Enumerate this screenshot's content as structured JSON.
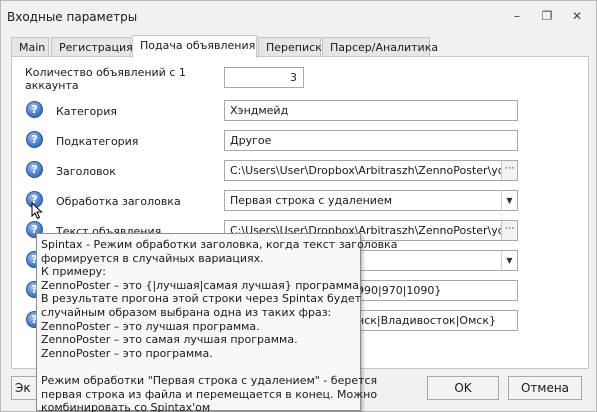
{
  "window": {
    "title": "Входные параметры"
  },
  "tabs": [
    {
      "label": "Main"
    },
    {
      "label": "Регистрация"
    },
    {
      "label": "Подача объявления",
      "active": true
    },
    {
      "label": "Переписка"
    },
    {
      "label": "Парсер/Аналитика"
    }
  ],
  "form": {
    "count_label": "Количество объявлений с 1 аккаунта",
    "count_label_line1": "Количество объявлений с 1",
    "count_label_line2": "аккаунта",
    "count_value": "3",
    "category_label": "Категория",
    "category_value": "Хэндмейд",
    "subcategory_label": "Подкатегория",
    "subcategory_value": "Другое",
    "title_label": "Заголовок",
    "title_value": "C:\\Users\\User\\Dropbox\\Arbitraszh\\ZennoPoster\\youla.ic",
    "title_processing_label": "Обработка заголовка",
    "title_processing_value": "Первая строка с удалением",
    "ad_text_label": "Текст объявления",
    "ad_text_value": "C:\\Users\\User\\Dropbox\\Arbitraszh\\ZennoPoster\\youla.ic",
    "price_partial": "990|970|1090}",
    "cities_partial": "нск|Владивосток|Омск}"
  },
  "tooltip": {
    "lines": [
      "Spintax - Режим обработки заголовка, когда текст заголовка",
      "формируется в случайных вариациях.",
      "К примеру:",
      "ZennoPoster – это {|лучшая|самая лучшая} программа.",
      "В результате прогона этой строки через Spintax будет",
      "случайным образом выбрана одна из таких фраз:",
      "ZennoPoster – это лучшая программа.",
      "ZennoPoster – это самая лучшая программа.",
      "ZennoPoster – это программа.",
      "",
      "Режим обработки \"Первая строка с удалением\" - берется",
      "первая строка из файла и перемещается в конец. Можно",
      "комбинировать со Spintax'ом"
    ]
  },
  "footer": {
    "left_button_partial": "Эк",
    "ok_label": "OK",
    "cancel_label": "Отмена"
  },
  "icons": {
    "help": "question-circle-icon",
    "browse": "ellipsis-icon",
    "dropdown": "chevron-down-icon",
    "minimize": "minimize-icon",
    "restore": "restore-icon",
    "close": "close-icon"
  }
}
